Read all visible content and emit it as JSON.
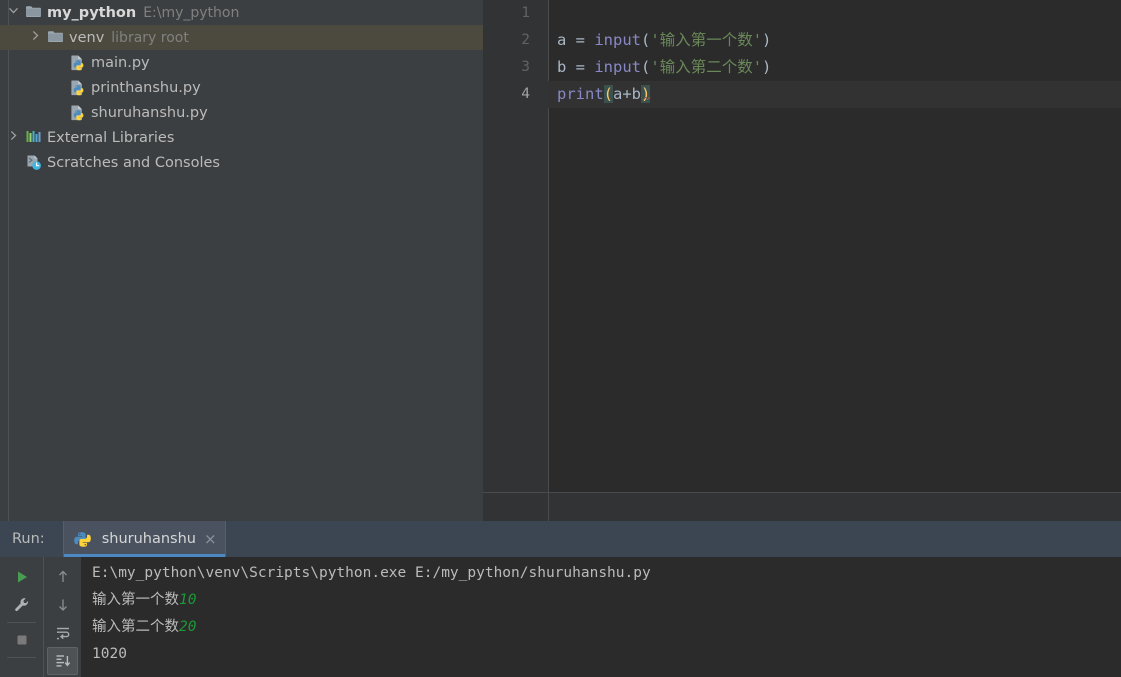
{
  "project": {
    "tree": [
      {
        "id": "my_python",
        "label": "my_python",
        "sub": "E:\\my_python",
        "icon": "folder-icon",
        "arrow": "chevron-down-icon",
        "indent": 0,
        "bold": true,
        "selected": false
      },
      {
        "id": "venv",
        "label": "venv",
        "sub": "library root",
        "icon": "folder-icon",
        "arrow": "chevron-right-icon",
        "indent": 1,
        "bold": false,
        "selected": true
      },
      {
        "id": "main-py",
        "label": "main.py",
        "sub": "",
        "icon": "python-file-icon",
        "arrow": "",
        "indent": 2,
        "bold": false,
        "selected": false
      },
      {
        "id": "printhanshu-py",
        "label": "printhanshu.py",
        "sub": "",
        "icon": "python-file-icon",
        "arrow": "",
        "indent": 2,
        "bold": false,
        "selected": false
      },
      {
        "id": "shuruhanshu-py",
        "label": "shuruhanshu.py",
        "sub": "",
        "icon": "python-file-icon",
        "arrow": "",
        "indent": 2,
        "bold": false,
        "selected": false
      },
      {
        "id": "external-libraries",
        "label": "External Libraries",
        "sub": "",
        "icon": "libraries-icon",
        "arrow": "chevron-right-icon",
        "indent": 0,
        "bold": false,
        "selected": false
      },
      {
        "id": "scratches-and-consoles",
        "label": "Scratches and Consoles",
        "sub": "",
        "icon": "scratches-icon",
        "arrow": "",
        "indent": 0,
        "bold": false,
        "selected": false
      }
    ]
  },
  "editor": {
    "active_line": 4,
    "line_numbers": [
      "1",
      "2",
      "3",
      "4"
    ],
    "lines": [
      {
        "n": "1",
        "plain": ""
      },
      {
        "n": "2",
        "plain": "a = input('输入第一个数')"
      },
      {
        "n": "3",
        "plain": "b = input('输入第二个数')"
      },
      {
        "n": "4",
        "plain": "print(a+b)"
      }
    ],
    "line2": {
      "var": "a",
      "eq": " = ",
      "fn": "input",
      "open": "(",
      "str": "'输入第一个数'",
      "close": ")"
    },
    "line3": {
      "var": "b",
      "eq": " = ",
      "fn": "input",
      "open": "(",
      "str": "'输入第二个数'",
      "close": ")"
    },
    "line4": {
      "fn": "print",
      "open": "(",
      "expr": "a+b",
      "close": ")"
    },
    "colors": {
      "function": "#8888c6",
      "string": "#6a8759",
      "default_text": "#a9b7c6",
      "matched_brace": "#ffc66d",
      "matched_brace_bg": "#3b514d",
      "current_line_bg": "#323232",
      "editor_bg": "#2b2b2b",
      "gutter_bg": "#313335"
    }
  },
  "run_tool_window": {
    "title": "Run:",
    "tab": {
      "label": "shuruhanshu",
      "icon": "python-icon",
      "close": "×"
    },
    "toolbar_left": [
      {
        "id": "rerun",
        "name": "run-icon",
        "label": "Rerun"
      },
      {
        "id": "settings",
        "name": "wrench-icon",
        "label": "Modify Run Configuration"
      },
      {
        "id": "stop",
        "name": "stop-icon",
        "label": "Stop"
      }
    ],
    "toolbar_right": [
      {
        "id": "up",
        "name": "arrow-up-icon",
        "label": "Up the Stack Trace"
      },
      {
        "id": "down",
        "name": "arrow-down-icon",
        "label": "Down the Stack Trace"
      },
      {
        "id": "softwrap",
        "name": "soft-wrap-icon",
        "label": "Use Soft Wraps"
      },
      {
        "id": "scrollend",
        "name": "scroll-to-end-icon",
        "label": "Scroll to End",
        "pressed": true
      }
    ],
    "console": {
      "command": "E:\\my_python\\venv\\Scripts\\python.exe E:/my_python/shuruhanshu.py",
      "lines": [
        {
          "prompt": "输入第一个数",
          "input": "10"
        },
        {
          "prompt": "输入第二个数",
          "input": "20"
        }
      ],
      "result": "1020",
      "input_color": "#1a9a35"
    }
  },
  "theme": {
    "panel_bg": "#3c3f41",
    "editor_bg": "#2b2b2b",
    "selection_bg": "#4c4a3e",
    "run_header_bg": "#3c4552",
    "tab_active_bg": "#4a5260",
    "tab_underline": "#4b88c4",
    "text": "#bbbbbb",
    "text_dim": "#808080"
  }
}
